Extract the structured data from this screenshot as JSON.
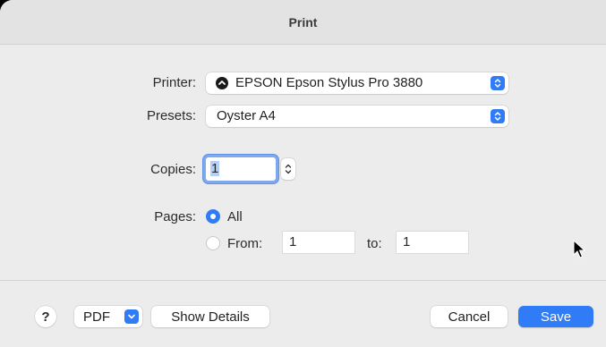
{
  "window": {
    "title": "Print"
  },
  "printer": {
    "label": "Printer:",
    "value": "EPSON Epson Stylus Pro 3880"
  },
  "presets": {
    "label": "Presets:",
    "value": "Oyster A4"
  },
  "copies": {
    "label": "Copies:",
    "value": "1"
  },
  "pages": {
    "label": "Pages:",
    "all_label": "All",
    "from_label": "From:",
    "to_label": "to:",
    "from_value": "1",
    "to_value": "1",
    "selected": "All"
  },
  "footer": {
    "help_label": "?",
    "pdf_label": "PDF",
    "show_details_label": "Show Details",
    "cancel_label": "Cancel",
    "save_label": "Save"
  },
  "colors": {
    "accent": "#2f7cf6",
    "dialog_bg": "#ececec",
    "titlebar_bg": "#e3e3e3"
  },
  "icons": {
    "printer": "printer-status-icon",
    "stepper": "up-down-chevron-icon",
    "cursor": "mouse-pointer-icon"
  }
}
